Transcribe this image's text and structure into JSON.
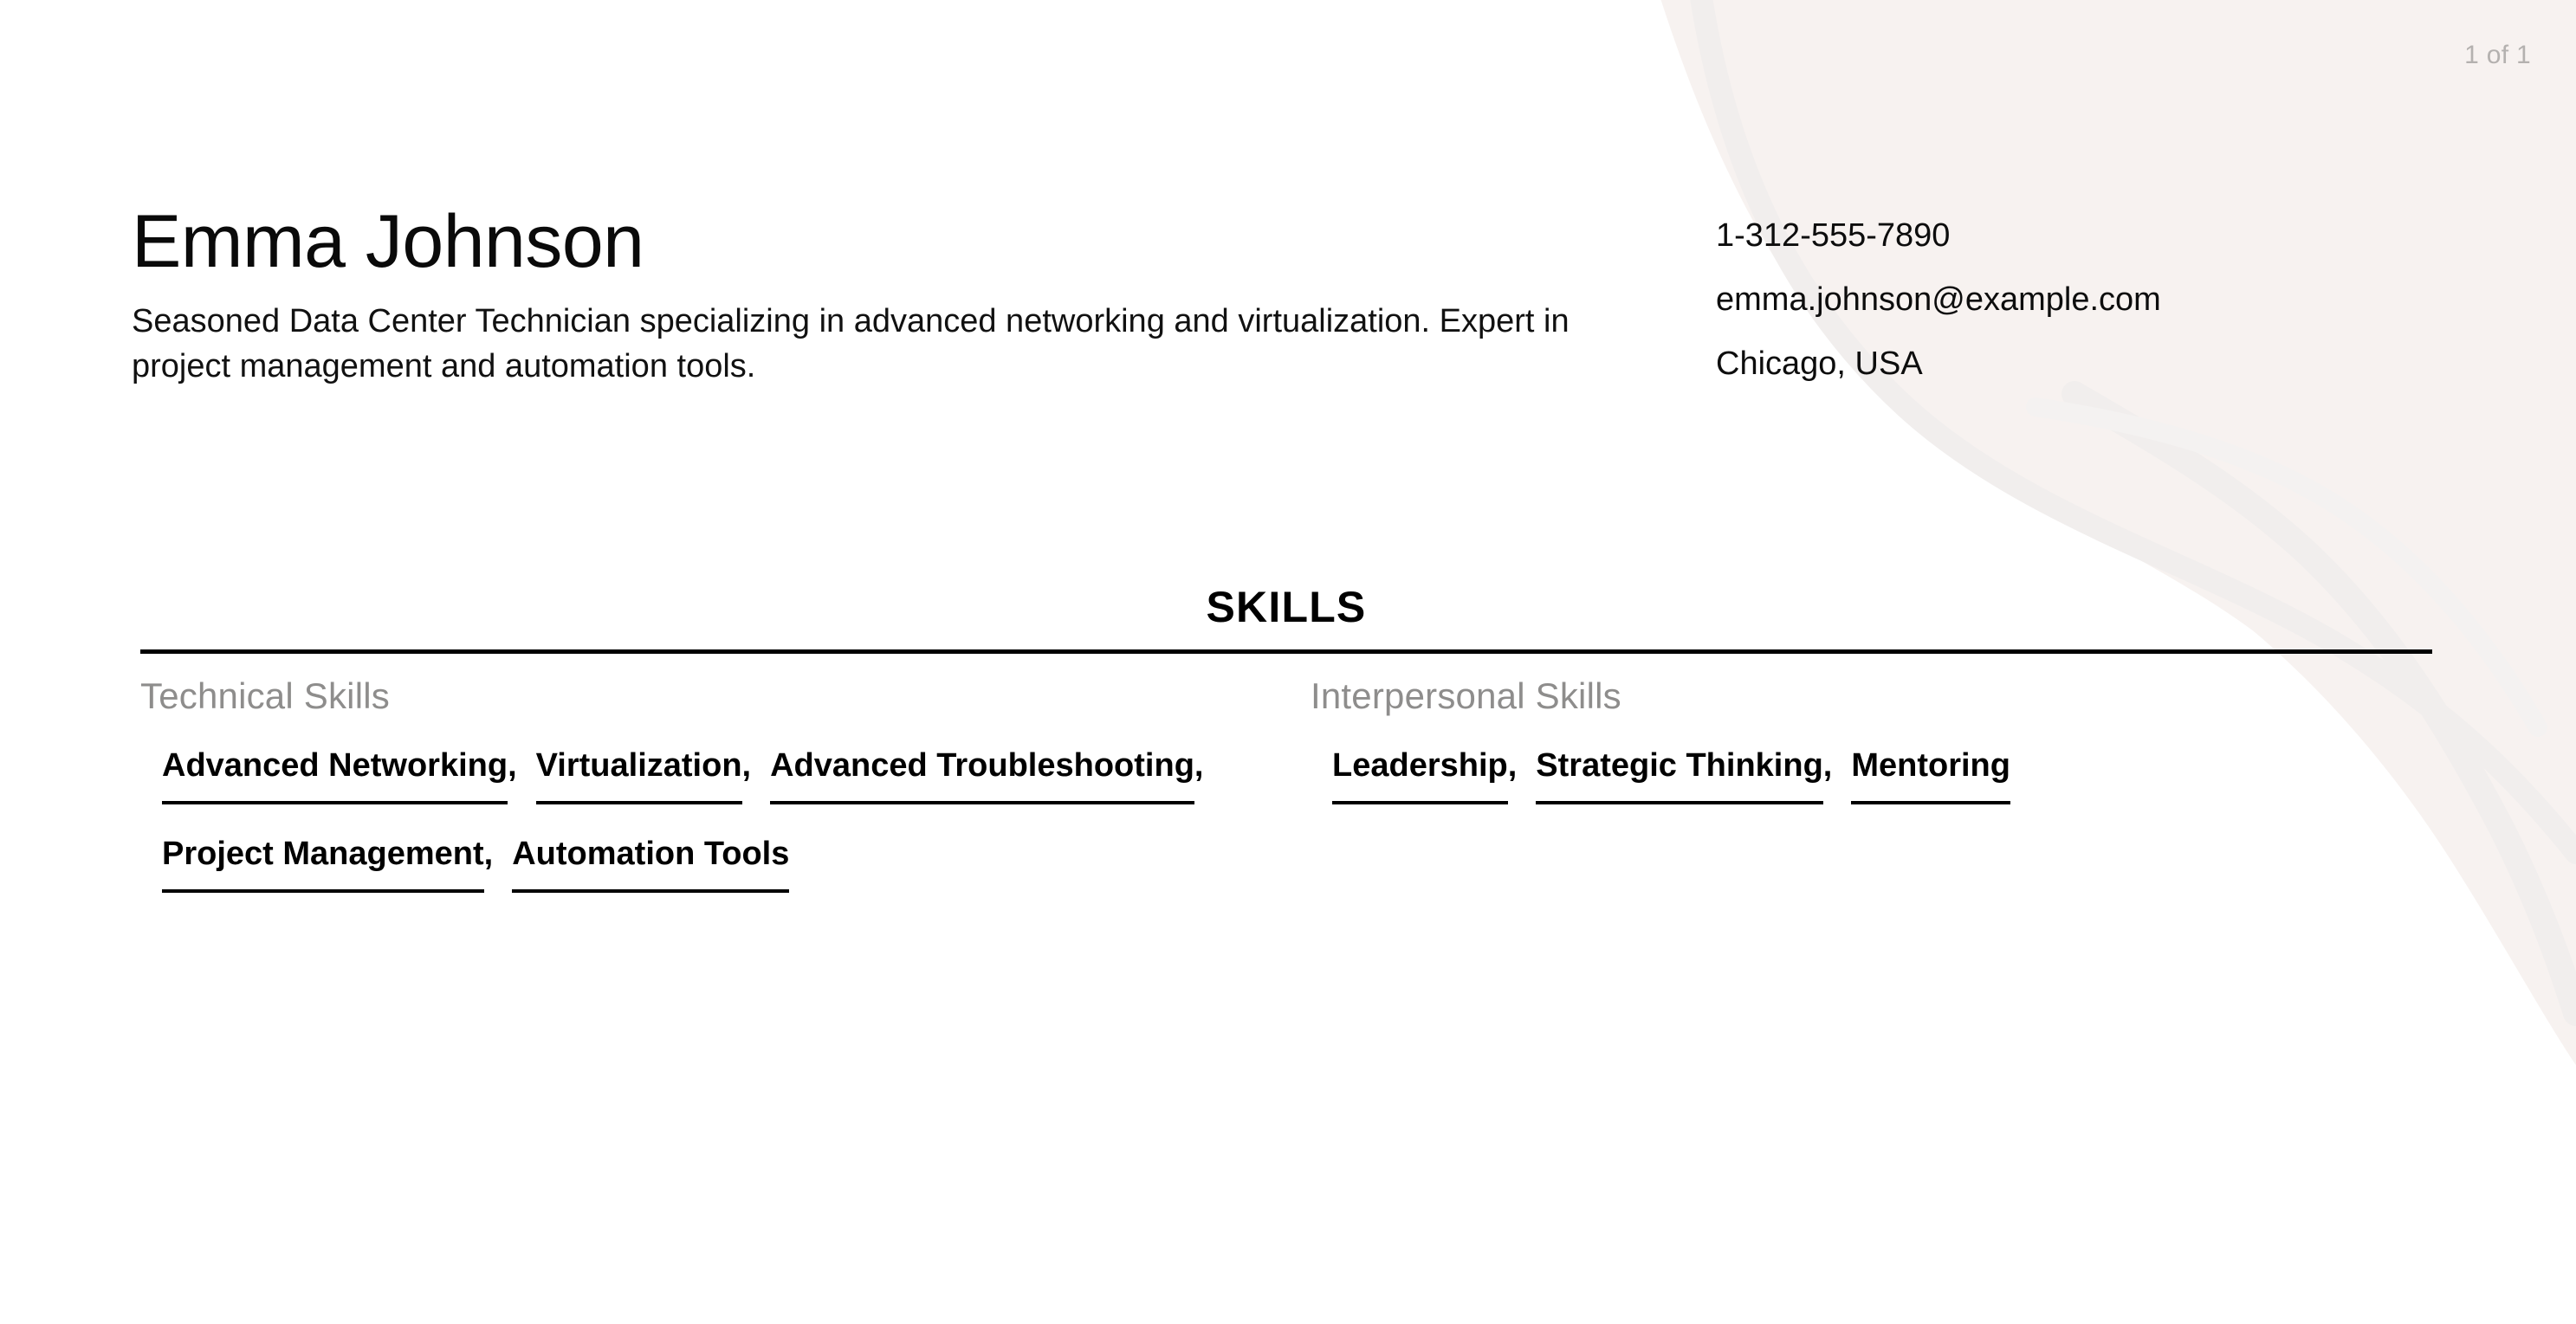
{
  "page_indicator": "1 of 1",
  "colors": {
    "page_background": "#ffffff",
    "decor_blob": "#f7f2f0",
    "decor_wave": "#f4f2f1",
    "rule": "#000000",
    "group_title_gray": "#8e8d8c",
    "page_indicator_gray": "#b4b1af",
    "text": "#000000"
  },
  "header": {
    "full_name": "Emma Johnson",
    "summary": "Seasoned Data Center Technician specializing in advanced networking and virtualization. Expert in project management and automation tools."
  },
  "contact": {
    "phone": "1-312-555-7890",
    "email": "emma.johnson@example.com",
    "location": "Chicago, USA"
  },
  "skills_section": {
    "title": "SKILLS",
    "groups": [
      {
        "title": "Technical Skills",
        "items": [
          {
            "name": "Advanced Networking",
            "separator": ","
          },
          {
            "name": "Virtualization",
            "separator": ","
          },
          {
            "name": "Advanced Troubleshooting",
            "separator": ","
          },
          {
            "name": "Project Management",
            "separator": ","
          },
          {
            "name": "Automation Tools",
            "separator": ""
          }
        ]
      },
      {
        "title": "Interpersonal Skills",
        "items": [
          {
            "name": "Leadership",
            "separator": ","
          },
          {
            "name": "Strategic Thinking",
            "separator": ","
          },
          {
            "name": "Mentoring",
            "separator": ""
          }
        ]
      }
    ]
  }
}
